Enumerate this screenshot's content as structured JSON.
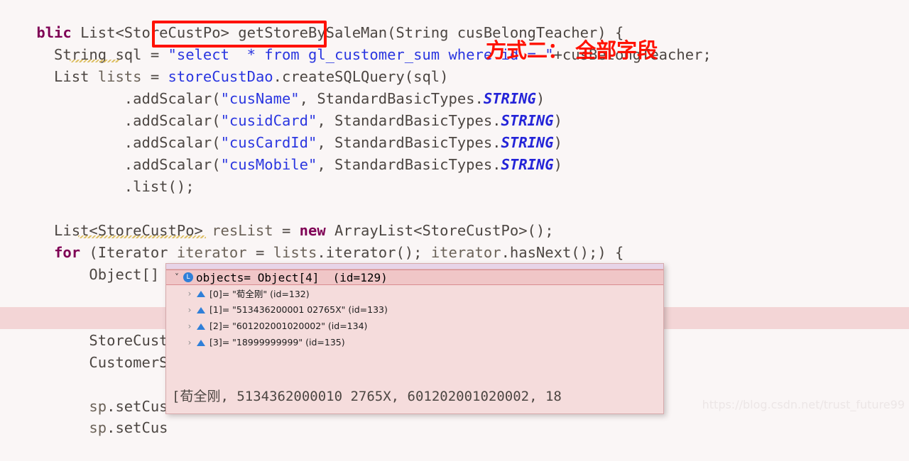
{
  "editor": {
    "background_color": "#faf6f6",
    "highlight_row_color": "#f3d5d6",
    "lines": [
      {
        "indent": 0,
        "text": "blic List<StoreCustPo> getStoreBySaleMan(String cusBelongTeacher) {"
      },
      {
        "indent": 0,
        "text": "String sql = \"select  * from gl_customer_sum where id = \"+cusBelongTeacher;"
      },
      {
        "indent": 0,
        "text": "List lists = storeCustDao.createSQLQuery(sql)"
      },
      {
        "indent": 0,
        "text": ".addScalar(\"cusName\", StandardBasicTypes.STRING)"
      },
      {
        "indent": 0,
        "text": ".addScalar(\"cusidCard\", StandardBasicTypes.STRING)"
      },
      {
        "indent": 0,
        "text": ".addScalar(\"cusCardId\", StandardBasicTypes.STRING)"
      },
      {
        "indent": 0,
        "text": ".addScalar(\"cusMobile\", StandardBasicTypes.STRING)"
      },
      {
        "indent": 0,
        "text": ".list();"
      },
      {
        "indent": 0,
        "text": ""
      },
      {
        "indent": 0,
        "text": "List<StoreCustPo> resList = new ArrayList<StoreCustPo>();"
      },
      {
        "indent": 0,
        "text": "for (Iterator iterator = lists.iterator(); iterator.hasNext();) {"
      },
      {
        "indent": 0,
        "text": "Object[] objects = (Object[]) iterator.next();"
      },
      {
        "indent": 0,
        "text": ""
      },
      {
        "indent": 0,
        "text": ""
      },
      {
        "indent": 0,
        "text": "StoreCust"
      },
      {
        "indent": 0,
        "text": "CustomerS"
      },
      {
        "indent": 0,
        "text": ""
      },
      {
        "indent": 0,
        "text": "sp.setCus"
      },
      {
        "indent": 0,
        "text": "sp.setCus"
      }
    ]
  },
  "annotation": {
    "sql_box_label": "\"select  * from ",
    "note_text": "方式二： 全部字段",
    "color": "#ff1100"
  },
  "popup": {
    "header": {
      "icon": "local-variable-icon",
      "chevron": "chevron-down-icon",
      "label": "objects= Object[4]  (id=129)"
    },
    "rows": [
      {
        "chevron": "chevron-right-icon",
        "icon": "public-field-icon",
        "label": "[0]= \"荀全刚\" (id=132)"
      },
      {
        "chevron": "chevron-right-icon",
        "icon": "public-field-icon",
        "label": "[1]= \"513436200001 02765X\" (id=133)"
      },
      {
        "chevron": "chevron-right-icon",
        "icon": "public-field-icon",
        "label": "[2]= \"601202001020002\" (id=134)"
      },
      {
        "chevron": "chevron-right-icon",
        "icon": "public-field-icon",
        "label": "[3]= \"18999999999\" (id=135)"
      }
    ],
    "value_text": "[荀全刚, 5134362000010 2765X, 601202001020002, 18",
    "header_bg": "#f0c6c7",
    "body_bg": "#f5dcdc"
  },
  "watermark": {
    "text": "https://blog.csdn.net/trust_future99"
  }
}
